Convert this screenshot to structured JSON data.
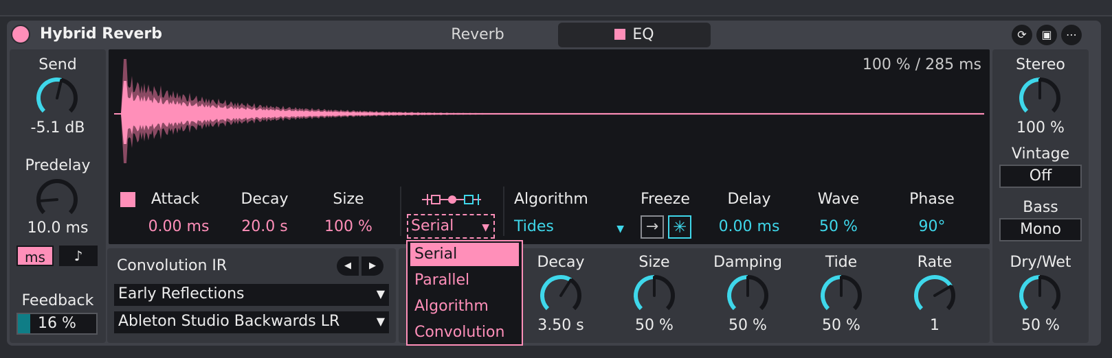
{
  "device": {
    "title": "Hybrid Reverb",
    "tabs": [
      {
        "label": "Reverb"
      },
      {
        "label": "EQ"
      }
    ],
    "colors": {
      "accent_pink": "#ff8fb9",
      "accent_cyan": "#3fd7ea",
      "panel": "#404249",
      "display": "#15161a"
    },
    "header_icons": [
      "refresh-icon",
      "save-icon",
      "more-icon"
    ]
  },
  "left": {
    "send": {
      "label": "Send",
      "value": "-5.1 dB",
      "level": 0.55
    },
    "predelay": {
      "label": "Predelay",
      "value": "10.0 ms",
      "level": 0.15
    },
    "mode_ms": "ms",
    "mode_note": "♪",
    "feedback": {
      "label": "Feedback",
      "value": "16 %",
      "level": 0.16
    }
  },
  "display": {
    "readout": "100 % / 285 ms",
    "attack": {
      "label": "Attack",
      "value": "0.00 ms"
    },
    "decay": {
      "label": "Decay",
      "value": "20.0 s"
    },
    "size": {
      "label": "Size",
      "value": "100 %"
    },
    "routing": {
      "value": "Serial"
    },
    "algorithm": {
      "label": "Algorithm",
      "value": "Tides"
    },
    "freeze": {
      "label": "Freeze"
    },
    "delay": {
      "label": "Delay",
      "value": "0.00 ms"
    },
    "wave": {
      "label": "Wave",
      "value": "50 %"
    },
    "phase": {
      "label": "Phase",
      "value": "90°"
    }
  },
  "convolution": {
    "label": "Convolution IR",
    "category": "Early Reflections",
    "ir": "Ableton Studio Backwards LR"
  },
  "routing_menu": {
    "options": [
      "Serial",
      "Parallel",
      "Algorithm",
      "Convolution"
    ],
    "selected": "Serial"
  },
  "algo_knobs": [
    {
      "label": "Decay",
      "value": "3.50 s",
      "level": 0.62
    },
    {
      "label": "Size",
      "value": "50 %",
      "level": 0.5
    },
    {
      "label": "Damping",
      "value": "50 %",
      "level": 0.5
    },
    {
      "label": "Tide",
      "value": "50 %",
      "level": 0.5
    },
    {
      "label": "Rate",
      "value": "1",
      "level": 0.72
    }
  ],
  "right": {
    "stereo": {
      "label": "Stereo",
      "value": "100 %",
      "level": 0.5
    },
    "vintage": {
      "label": "Vintage",
      "value": "Off"
    },
    "bass": {
      "label": "Bass",
      "value": "Mono"
    },
    "drywet": {
      "label": "Dry/Wet",
      "value": "50 %",
      "level": 0.5
    }
  }
}
